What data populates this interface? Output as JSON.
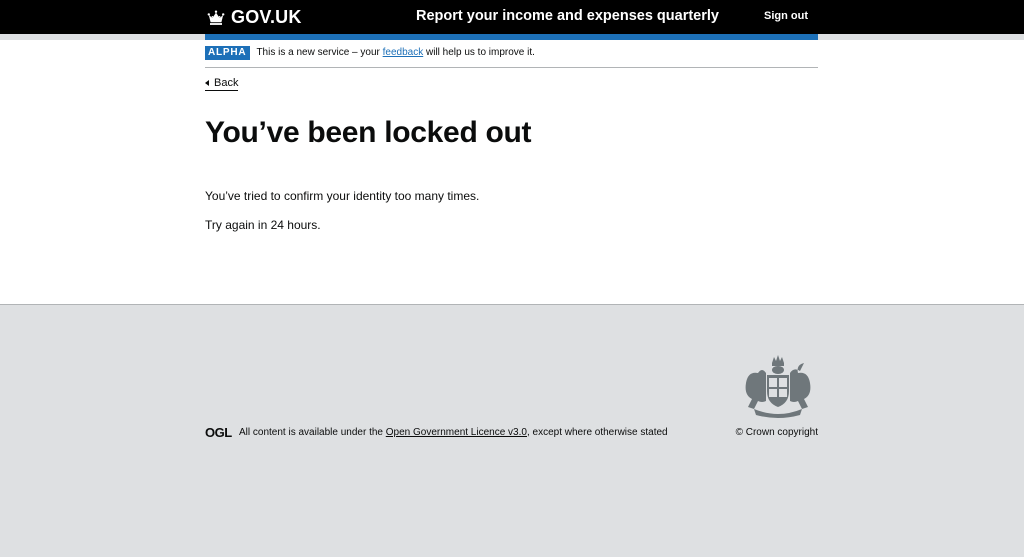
{
  "header": {
    "logo_text": "GOV.UK",
    "service_name": "Report your income and expenses quarterly",
    "sign_out": "Sign out",
    "accent_color": "#1d70b8"
  },
  "phase_banner": {
    "tag": "ALPHA",
    "text_before": "This is a new service – your ",
    "link": "feedback",
    "text_after": " will help us to improve it."
  },
  "back_link": "Back",
  "main": {
    "heading": "You’ve been locked out",
    "paragraphs": [
      "You’ve tried to confirm your identity too many times.",
      "Try again in 24 hours."
    ]
  },
  "footer": {
    "ogl_logo": "OGL",
    "licence_before": "All content is available under the ",
    "licence_link": "Open Government Licence v3.0",
    "licence_after": ", except where otherwise stated",
    "crest_icon": "royal-coat-of-arms-icon",
    "crown_copyright": "© Crown copyright"
  }
}
